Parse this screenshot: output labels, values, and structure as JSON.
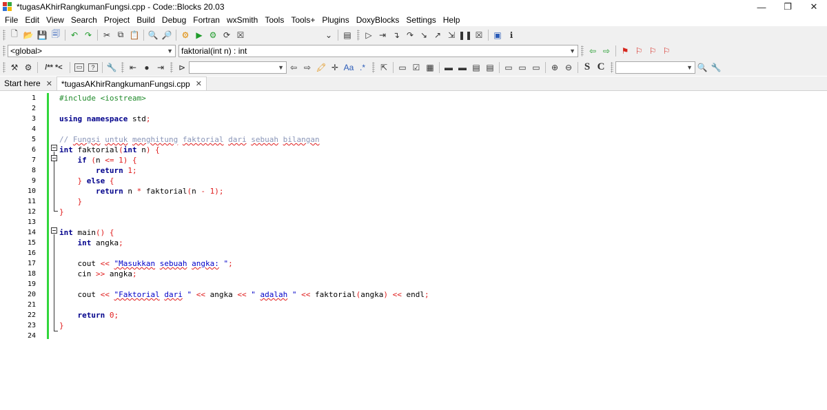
{
  "window": {
    "title": "*tugasAKhirRangkumanFungsi.cpp - Code::Blocks 20.03",
    "controls": [
      "—",
      "❐",
      "✕"
    ]
  },
  "menu": [
    "File",
    "Edit",
    "View",
    "Search",
    "Project",
    "Build",
    "Debug",
    "Fortran",
    "wxSmith",
    "Tools",
    "Tools+",
    "Plugins",
    "DoxyBlocks",
    "Settings",
    "Help"
  ],
  "toolbar2": {
    "scope_value": "<global>",
    "function_value": "faktorial(int n) : int"
  },
  "toolbar3": {
    "doxy_comment_label": "/** *<",
    "search_value": "",
    "search_value2": ""
  },
  "tabs": [
    {
      "label": "Start here",
      "active": false
    },
    {
      "label": "*tugasAKhirRangkumanFungsi.cpp",
      "active": true
    }
  ],
  "editor": {
    "line_numbers": [
      "1",
      "2",
      "3",
      "4",
      "5",
      "6",
      "7",
      "8",
      "9",
      "10",
      "11",
      "12",
      "13",
      "14",
      "15",
      "16",
      "17",
      "18",
      "19",
      "20",
      "21",
      "22",
      "23",
      "24"
    ],
    "lines": [
      "#include <iostream>",
      "",
      "using namespace std;",
      "",
      "// Fungsi untuk menghitung faktorial dari sebuah bilangan",
      "int faktorial(int n) {",
      "    if (n <= 1) {",
      "        return 1;",
      "    } else {",
      "        return n * faktorial(n - 1);",
      "    }",
      "}",
      "",
      "int main() {",
      "    int angka;",
      "",
      "    cout << \"Masukkan sebuah angka: \";",
      "    cin >> angka;",
      "",
      "    cout << \"Faktorial dari \" << angka << \" adalah \" << faktorial(angka) << endl;",
      "",
      "    return 0;",
      "}",
      ""
    ]
  },
  "colors": {
    "preprocessor": "#1f8a2a",
    "keyword": "#00008b",
    "operator": "#e01b1b",
    "string": "#0000c8",
    "comment": "#8a96b8",
    "changebar": "#31d63b"
  }
}
